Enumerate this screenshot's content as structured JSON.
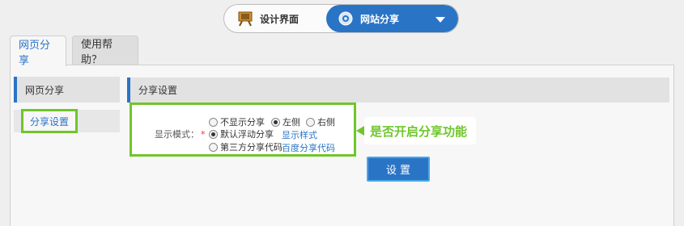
{
  "top_switch": {
    "design_label": "设计界面",
    "share_label": "网站分享",
    "design_icon": "easel-icon",
    "share_icon": "gear-icon",
    "active_color": "#2a74c6"
  },
  "tabs": [
    {
      "label": "网页分享",
      "active": true
    },
    {
      "label": "使用帮助？",
      "active": false
    }
  ],
  "sidebar": {
    "header": "网页分享",
    "items": [
      {
        "label": "分享设置",
        "selected": true
      }
    ]
  },
  "section": {
    "title": "分享设置",
    "mode_label": "显示模式：",
    "required_mark": "*",
    "options": [
      {
        "label": "不显示分享",
        "checked": false
      },
      {
        "label": "左侧",
        "checked": true
      },
      {
        "label": "右侧",
        "checked": false
      },
      {
        "label": "默认浮动分享",
        "checked": true
      },
      {
        "label": "第三方分享代码",
        "checked": false
      }
    ],
    "links": {
      "show_style": "显示样式",
      "baidu_code": "百度分享代码"
    }
  },
  "callout": {
    "text": "是否开启分享功能",
    "color": "#6fc62a"
  },
  "settings_button": {
    "label": "设 置"
  }
}
